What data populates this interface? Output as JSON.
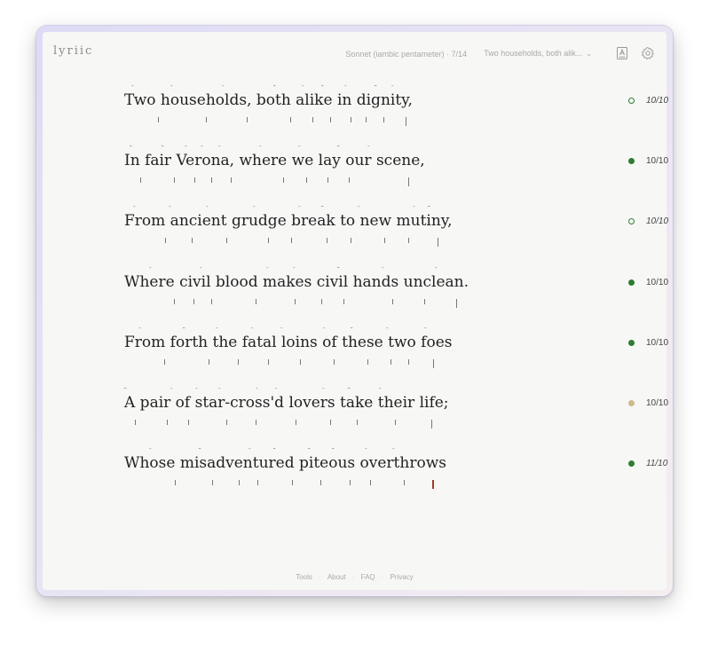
{
  "app": {
    "logo": "lyriic"
  },
  "header": {
    "meter_label": "Sonnet (iambic pentameter) · 7/14",
    "line_select": "Two households, both alik..."
  },
  "lines": [
    {
      "text": "Two households, both alike in dignity,",
      "score": "10/10",
      "italic": true,
      "status": "hollow-green"
    },
    {
      "text": "In fair Verona, where we lay our scene,",
      "score": "10/10",
      "italic": false,
      "status": "green"
    },
    {
      "text": "From ancient grudge break to new mutiny,",
      "score": "10/10",
      "italic": true,
      "status": "hollow-green"
    },
    {
      "text": "Where civil blood makes civil hands unclean.",
      "score": "10/10",
      "italic": false,
      "status": "green"
    },
    {
      "text": "From forth the fatal loins of these two foes",
      "score": "10/10",
      "italic": false,
      "status": "green"
    },
    {
      "text": "A pair of star-cross'd lovers take their life;",
      "score": "10/10",
      "italic": false,
      "status": "tan"
    },
    {
      "text": "Whose misadventured piteous overthrows",
      "score": "11/10",
      "italic": true,
      "status": "green"
    }
  ],
  "colors": {
    "green": "#2e7d32",
    "tan": "#cdbb8c"
  },
  "footer": {
    "links": [
      "Tools",
      "About",
      "FAQ",
      "Privacy"
    ]
  }
}
